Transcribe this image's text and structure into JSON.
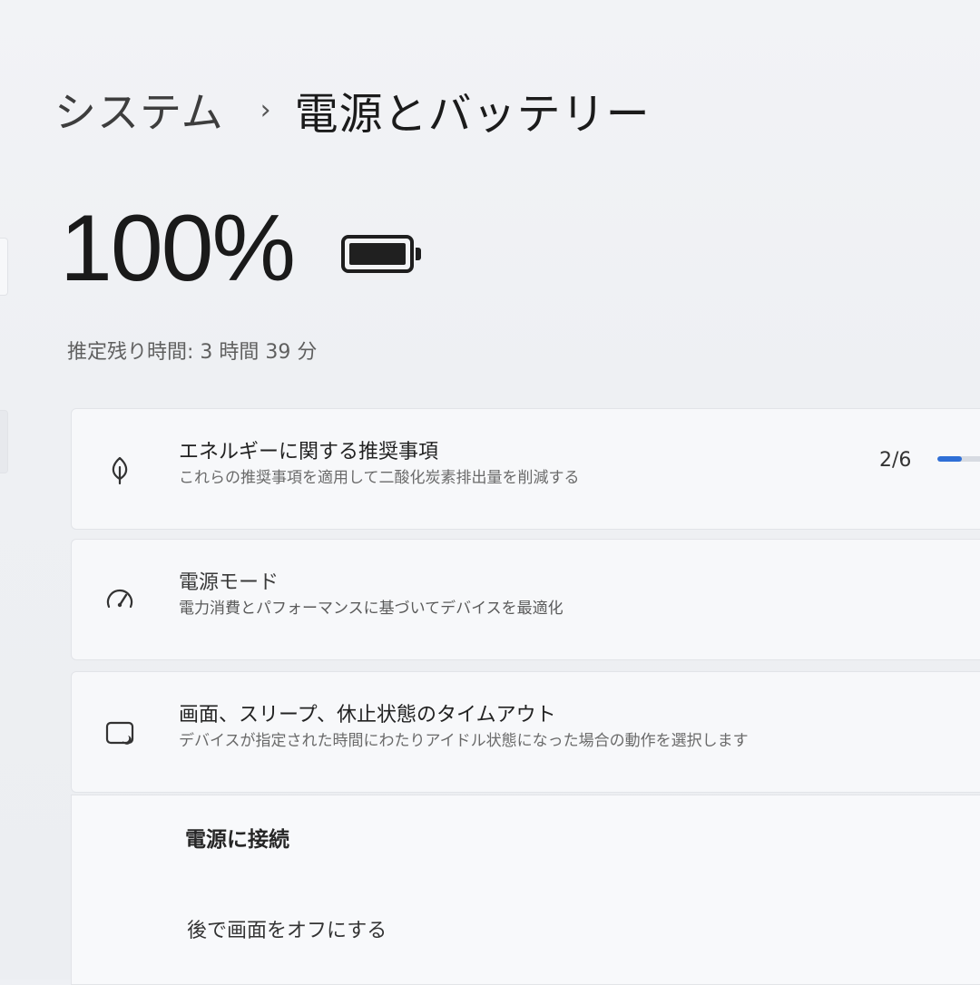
{
  "breadcrumb": {
    "parent": "システム",
    "separator": "›",
    "current": "電源とバッテリー"
  },
  "battery": {
    "percent_label": "100%",
    "level": 1.0,
    "icon": "battery-full-icon",
    "remaining_text": "推定残り時間: 3 時間 39 分"
  },
  "cards": {
    "energy": {
      "icon": "leaf-icon",
      "title": "エネルギーに関する推奨事項",
      "subtitle": "これらの推奨事項を適用して二酸化炭素排出量を削減する",
      "progress_label": "2/6",
      "progress_fraction": 0.333
    },
    "power_mode": {
      "icon": "gauge-icon",
      "title": "電源モード",
      "subtitle": "電力消費とパフォーマンスに基づいてデバイスを最適化"
    },
    "timeout": {
      "icon": "sleep-screen-icon",
      "title": "画面、スリープ、休止状態のタイムアウト",
      "subtitle": "デバイスが指定された時間にわたりアイドル状態になった場合の動作を選択します"
    }
  },
  "plugged_in": {
    "heading": "電源に接続",
    "screen_off_label": "後で画面をオフにする"
  },
  "colors": {
    "accent": "#2f6fd6",
    "background": "#eef0f4",
    "card": "#f7f8fa"
  }
}
